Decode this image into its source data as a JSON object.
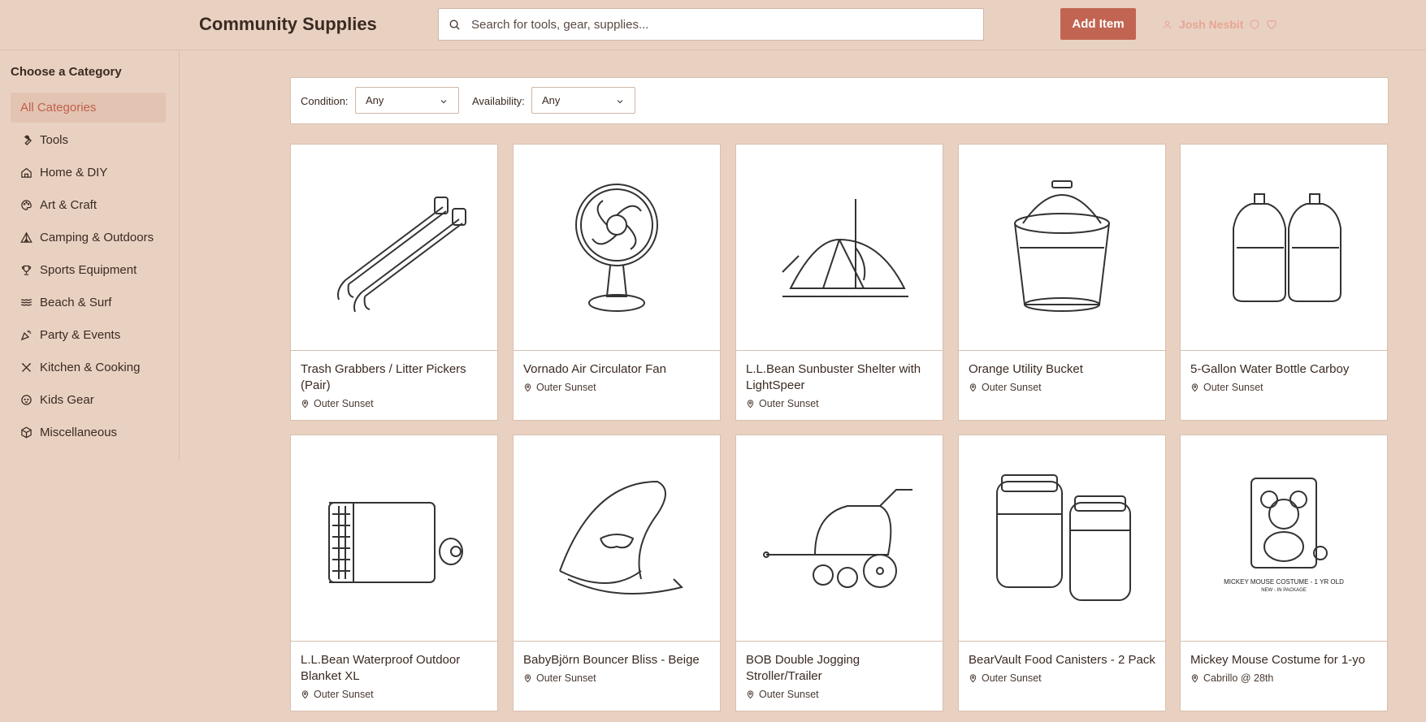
{
  "header": {
    "app_title": "Community Supplies",
    "search_placeholder": "Search for tools, gear, supplies...",
    "add_item_label": "Add Item",
    "user_name": "Josh Nesbit"
  },
  "sidebar": {
    "title": "Choose a Category",
    "items": [
      {
        "label": "All Categories",
        "icon": "none",
        "active": true
      },
      {
        "label": "Tools",
        "icon": "wrench-icon"
      },
      {
        "label": "Home & DIY",
        "icon": "home-icon"
      },
      {
        "label": "Art & Craft",
        "icon": "palette-icon"
      },
      {
        "label": "Camping & Outdoors",
        "icon": "tent-icon"
      },
      {
        "label": "Sports Equipment",
        "icon": "trophy-icon"
      },
      {
        "label": "Beach & Surf",
        "icon": "waves-icon"
      },
      {
        "label": "Party & Events",
        "icon": "party-popper-icon"
      },
      {
        "label": "Kitchen & Cooking",
        "icon": "utensils-icon"
      },
      {
        "label": "Kids Gear",
        "icon": "baby-icon"
      },
      {
        "label": "Miscellaneous",
        "icon": "package-icon"
      }
    ]
  },
  "filters": {
    "condition_label": "Condition:",
    "condition_value": "Any",
    "availability_label": "Availability:",
    "availability_value": "Any"
  },
  "items": [
    {
      "title": "Trash Grabbers / Litter Pickers (Pair)",
      "location": "Outer Sunset",
      "image": "grabber"
    },
    {
      "title": "Vornado Air Circulator Fan",
      "location": "Outer Sunset",
      "image": "fan"
    },
    {
      "title": "L.L.Bean Sunbuster Shelter with LightSpeer",
      "location": "Outer Sunset",
      "image": "tent"
    },
    {
      "title": "Orange Utility Bucket",
      "location": "Outer Sunset",
      "image": "bucket"
    },
    {
      "title": "5-Gallon Water Bottle Carboy",
      "location": "Outer Sunset",
      "image": "jugs"
    },
    {
      "title": "L.L.Bean Waterproof Outdoor Blanket XL",
      "location": "Outer Sunset",
      "image": "blanket"
    },
    {
      "title": "BabyBjörn Bouncer Bliss - Beige",
      "location": "Outer Sunset",
      "image": "bouncer"
    },
    {
      "title": "BOB Double Jogging Stroller/Trailer",
      "location": "Outer Sunset",
      "image": "stroller"
    },
    {
      "title": "BearVault Food Canisters - 2 Pack",
      "location": "Outer Sunset",
      "image": "canisters"
    },
    {
      "title": "Mickey Mouse Costume for 1-yo",
      "location": "Cabrillo @ 28th",
      "image": "costume",
      "image_caption": "MICKEY MOUSE COSTUME - 1 YR OLD",
      "image_caption2": "NEW - IN PACKAGE"
    }
  ]
}
